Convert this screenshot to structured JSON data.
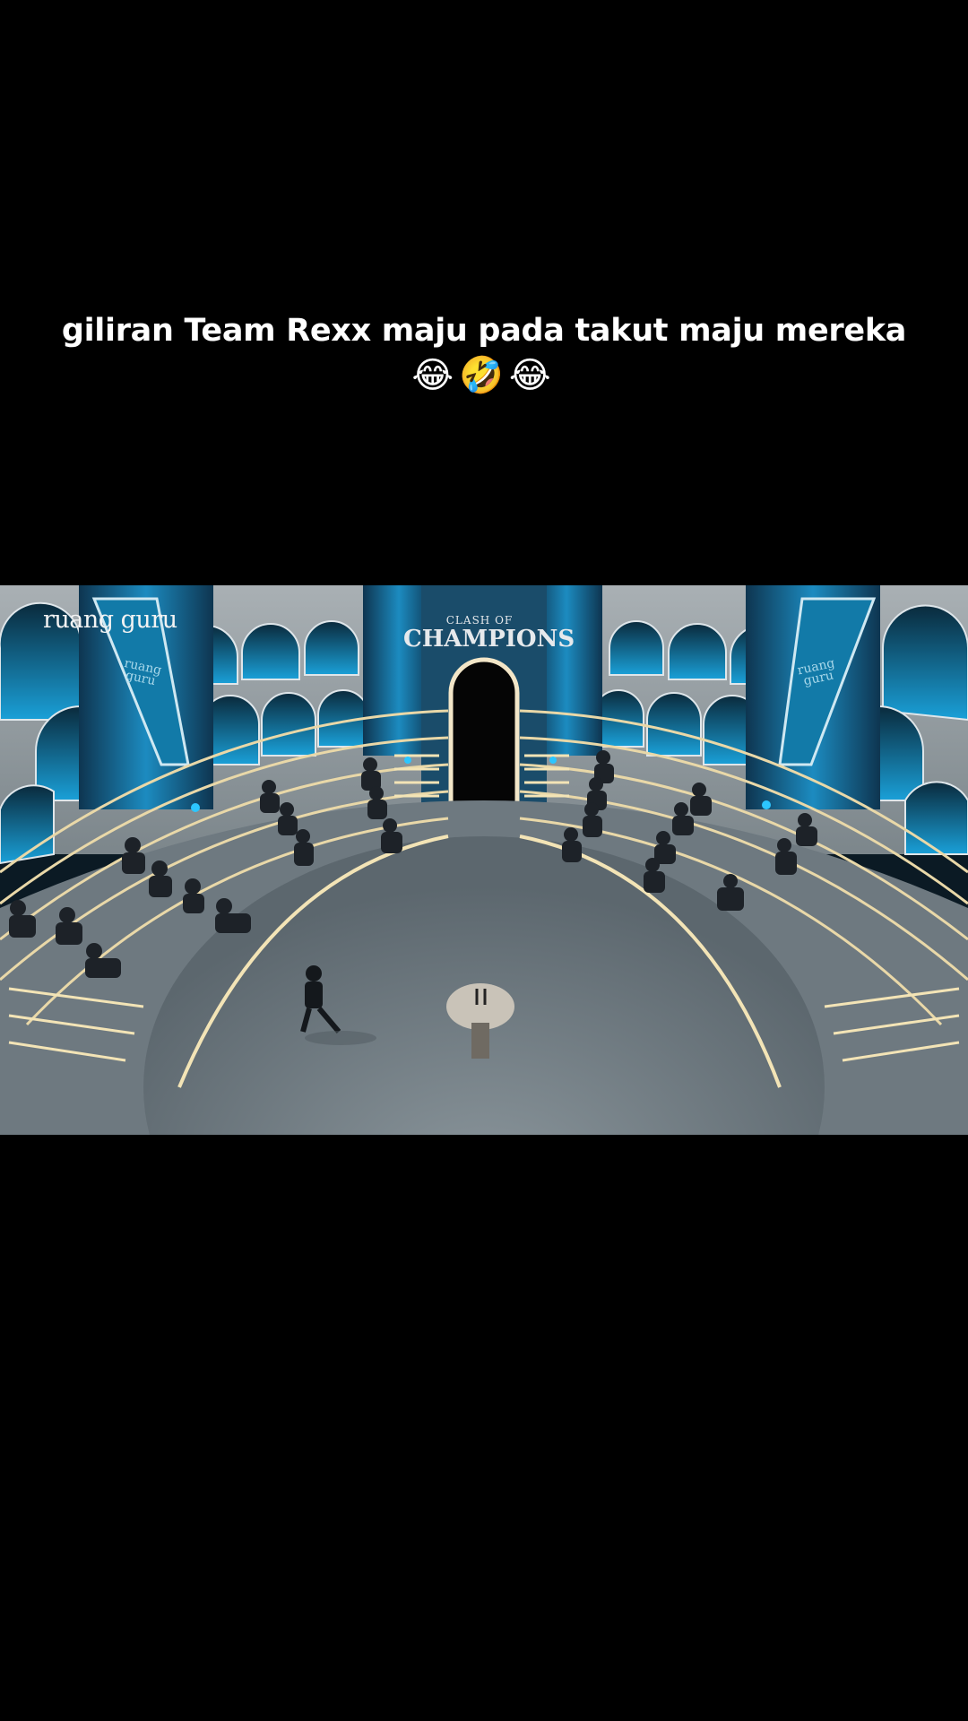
{
  "caption": {
    "line1": "giliran Team Rexx maju pada takut maju mereka",
    "emojis": "😂🤣😂"
  },
  "video": {
    "channel_logo": "ruang guru",
    "banner_left_text": "ruang guru",
    "banner_right_text": "ruang guru",
    "show_logo": {
      "top": "CLASH OF",
      "main": "CHAMPIONS"
    }
  },
  "colors": {
    "background": "#000000",
    "caption_text": "#ffffff",
    "accent_blue": "#1aa0d8"
  }
}
